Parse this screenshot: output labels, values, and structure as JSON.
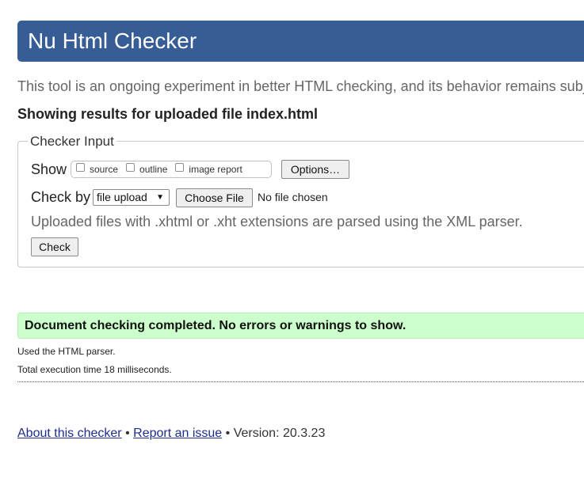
{
  "header": {
    "title": "Nu Html Checker"
  },
  "intro": "This tool is an ongoing experiment in better HTML checking, and its behavior remains subj",
  "results_for": "Showing results for uploaded file index.html",
  "checker_input": {
    "legend": "Checker Input",
    "show_label": "Show",
    "show_options": [
      {
        "label": "source",
        "checked": false
      },
      {
        "label": "outline",
        "checked": false
      },
      {
        "label": "image report",
        "checked": false
      }
    ],
    "options_button": "Options…",
    "check_by_label": "Check by",
    "check_by_selected": "file upload",
    "choose_file_button": "Choose File",
    "no_file_text": "No file chosen",
    "xml_note": "Uploaded files with .xhtml or .xht extensions are parsed using the XML parser.",
    "check_button": "Check"
  },
  "result": {
    "success_message": "Document checking completed. No errors or warnings to show.",
    "parser_note": "Used the HTML parser.",
    "time_note": "Total execution time 18 milliseconds."
  },
  "footer": {
    "about_link": "About this checker",
    "separator": "•",
    "report_link": "Report an issue",
    "version_text": "• Version: 20.3.23"
  },
  "colors": {
    "header_bg": "#365d95",
    "success_bg": "#ccffcc"
  }
}
